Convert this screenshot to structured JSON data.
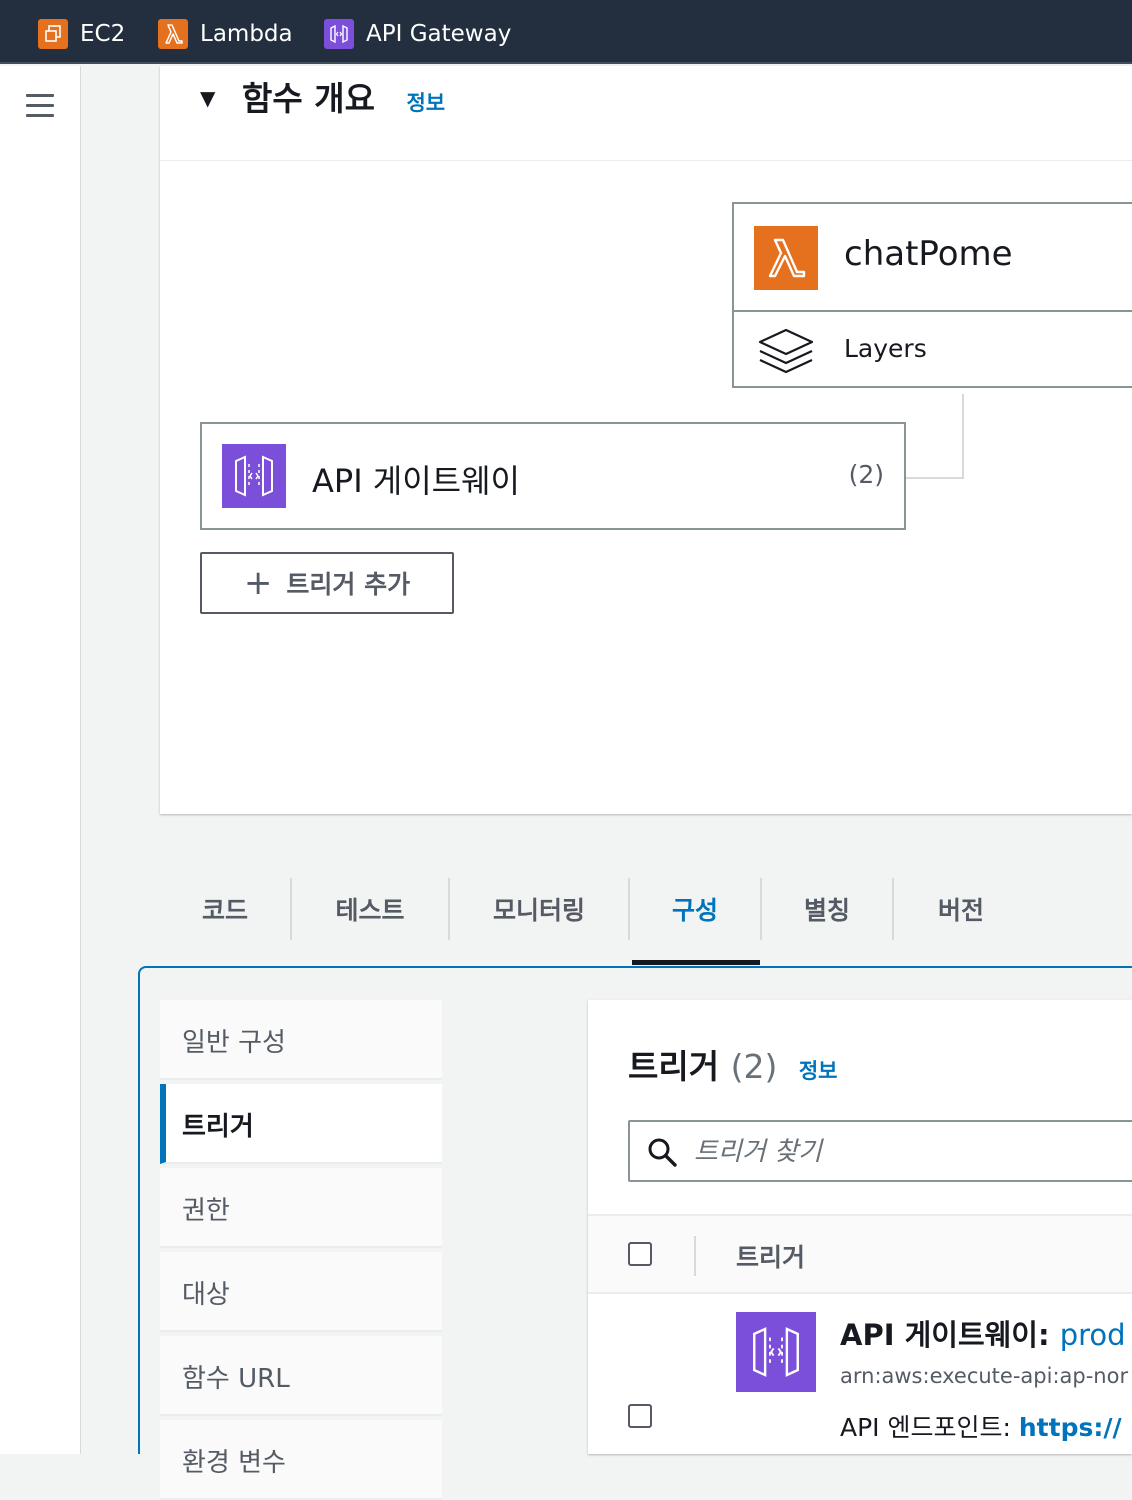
{
  "topbar": {
    "services": [
      {
        "label": "EC2",
        "icon": "ec2-icon",
        "color": "#e5711f"
      },
      {
        "label": "Lambda",
        "icon": "lambda-icon",
        "color": "#e5711f"
      },
      {
        "label": "API Gateway",
        "icon": "api-gateway-icon",
        "color": "#7b4fd9"
      }
    ]
  },
  "overview": {
    "title": "함수 개요",
    "info": "정보",
    "function_name": "chatPome",
    "layers_label": "Layers",
    "trigger_label": "API 게이트웨이",
    "trigger_count": "(2)",
    "add_trigger": "트리거 추가"
  },
  "tabs": [
    {
      "label": "코드"
    },
    {
      "label": "테스트"
    },
    {
      "label": "모니터링"
    },
    {
      "label": "구성",
      "active": true
    },
    {
      "label": "별칭"
    },
    {
      "label": "버전"
    }
  ],
  "config_nav": [
    {
      "label": "일반 구성"
    },
    {
      "label": "트리거",
      "active": true
    },
    {
      "label": "권한"
    },
    {
      "label": "대상"
    },
    {
      "label": "함수 URL"
    },
    {
      "label": "환경 변수"
    }
  ],
  "triggers_panel": {
    "title": "트리거",
    "count": "(2)",
    "info": "정보",
    "search_placeholder": "트리거 찾기",
    "column_header": "트리거",
    "row": {
      "title": "API 게이트웨이",
      "separator": ":",
      "stage": "prod",
      "arn": "arn:aws:execute-api:ap-nor",
      "endpoint_label": "API 엔드포인트:",
      "endpoint_url": "https://"
    }
  },
  "colors": {
    "accent": "#0073bb",
    "lambda": "#e5711f",
    "apigw": "#7b4fd9",
    "header_bg": "#232f3e"
  }
}
